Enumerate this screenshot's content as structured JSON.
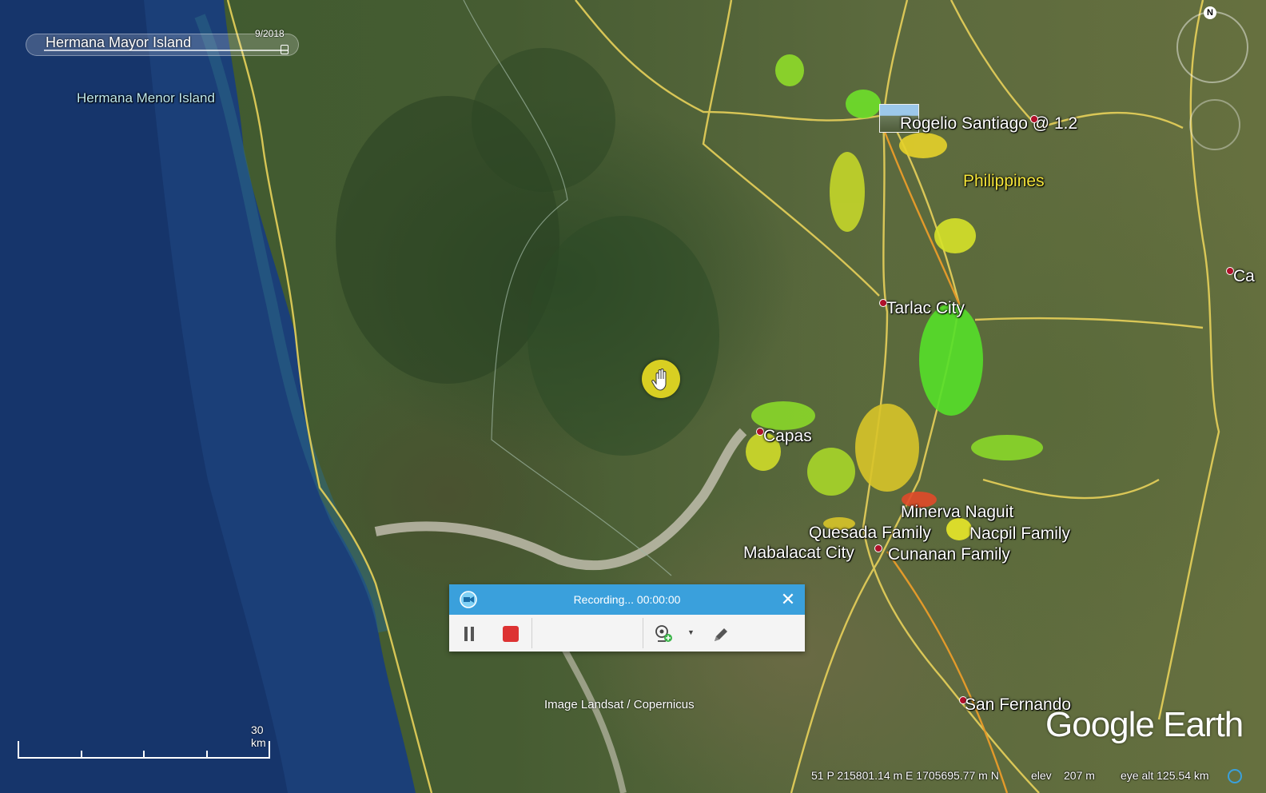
{
  "map": {
    "date": "9/2018",
    "search_place": "Hermana Mayor Island",
    "labels": {
      "hermana_menor": "Hermana Menor Island",
      "rogelio": "Rogelio Santiago @ 1.2",
      "philippines": "Philippines",
      "tarlac": "Tarlac City",
      "capas": "Capas",
      "minerva": "Minerva Naguit",
      "quesada": "Quesada Family",
      "nacpil": "Nacpil Family",
      "mabalacat": "Mabalacat City",
      "cunanan": "Cunanan Family",
      "san_fernando": "San Fernando",
      "ca_partial": "Ca"
    },
    "compass_label": "N",
    "credit": "Image Landsat / Copernicus",
    "logo": "Google Earth",
    "scale_label": "30 km"
  },
  "status": {
    "coords": "51 P 215801.14 m E 1705695.77 m N",
    "elev_label": "elev",
    "elev_value": "207 m",
    "eye_alt": "eye alt 125.54 km"
  },
  "recorder": {
    "title": "Recording... 00:00:00",
    "close_symbol": "✕",
    "icons": [
      "recorder-logo-icon",
      "pause-icon",
      "stop-icon",
      "webcam-add-icon",
      "chevron-down-icon",
      "pen-icon"
    ]
  },
  "colors": {
    "recorder_bar": "#3aa0dc",
    "stop": "#dd3333",
    "hand_cursor": "#d8cf22",
    "road": "#e8d15a",
    "label_yellow": "#f5e63a"
  }
}
